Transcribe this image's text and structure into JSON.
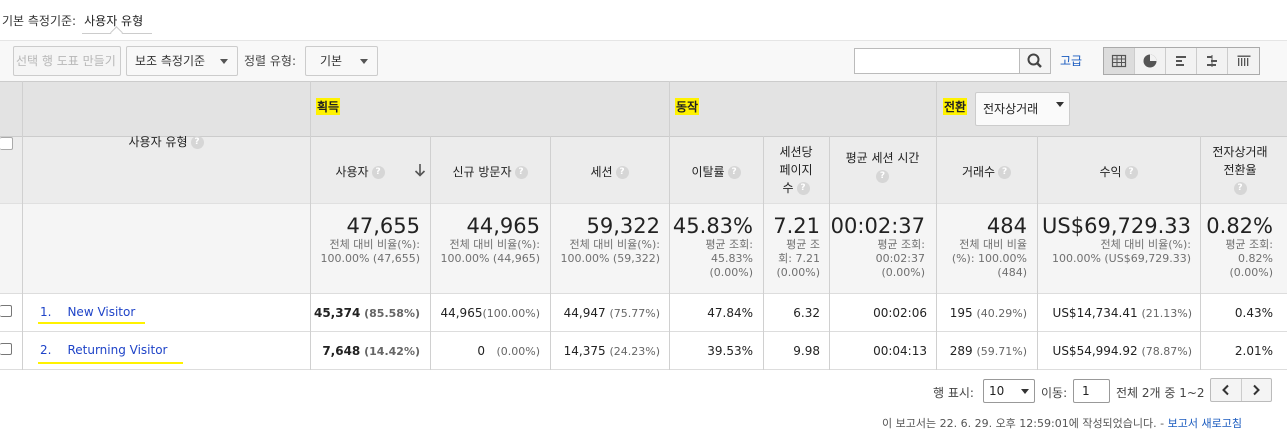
{
  "primary_dimension": {
    "label": "기본 측정기준:",
    "current": "사용자 유형"
  },
  "toolbar": {
    "create_chart": "선택 행 도표 만들기",
    "secondary_dimension": "보조 측정기준",
    "sort_type_label": "정렬 유형:",
    "sort_type_value": "기본",
    "advanced": "고급"
  },
  "table": {
    "dimension_header": "사용자 유형",
    "groups": {
      "acquisition": "획득",
      "behavior": "동작",
      "conversion": "전환",
      "conversion_select": "전자상거래"
    },
    "columns": {
      "users": "사용자",
      "new_visitors": "신규 방문자",
      "sessions": "세션",
      "bounce_rate": "이탈률",
      "pages_per_session_l1": "세션당",
      "pages_per_session_l2": "페이지",
      "pages_per_session_l3": "수",
      "avg_session_duration": "평균 세션 시간",
      "transactions": "거래수",
      "revenue": "수익",
      "ecommerce_rate_l1": "전자상거래",
      "ecommerce_rate_l2": "전환율"
    },
    "summary": {
      "users": {
        "value": "47,655",
        "sub1": "전체 대비 비율(%):",
        "sub2": "100.00% (47,655)"
      },
      "new_visitors": {
        "value": "44,965",
        "sub1": "전체 대비 비율(%):",
        "sub2": "100.00% (44,965)"
      },
      "sessions": {
        "value": "59,322",
        "sub1": "전체 대비 비율(%):",
        "sub2": "100.00% (59,322)"
      },
      "bounce_rate": {
        "value": "45.83%",
        "sub1": "평균 조회:",
        "sub2": "45.83%",
        "sub3": "(0.00%)"
      },
      "pages_per_session": {
        "value": "7.21",
        "sub1": "평균 조",
        "sub2": "회: 7.21",
        "sub3": "(0.00%)"
      },
      "avg_session_duration": {
        "value": "00:02:37",
        "sub1": "평균 조회:",
        "sub2": "00:02:37",
        "sub3": "(0.00%)"
      },
      "transactions": {
        "value": "484",
        "sub1": "전체 대비 비율",
        "sub2": "(%): 100.00%",
        "sub3": "(484)"
      },
      "revenue": {
        "value": "US$69,729.33",
        "sub1": "전체 대비 비율(%):",
        "sub2": "100.00% (US$69,729.33)"
      },
      "ecommerce_rate": {
        "value": "0.82%",
        "sub1": "평균 조회:",
        "sub2": "0.82%",
        "sub3": "(0.00%)"
      }
    },
    "rows": [
      {
        "index": "1.",
        "label": "New Visitor",
        "users": "45,374",
        "users_pct": "(85.58%)",
        "new_visitors": "44,965",
        "new_visitors_pct": "(100.00%)",
        "sessions": "44,947",
        "sessions_pct": "(75.77%)",
        "bounce_rate": "47.84%",
        "pages_per_session": "6.32",
        "avg_session_duration": "00:02:06",
        "transactions": "195",
        "transactions_pct": "(40.29%)",
        "revenue": "US$14,734.41",
        "revenue_pct": "(21.13%)",
        "ecommerce_rate": "0.43%"
      },
      {
        "index": "2.",
        "label": "Returning Visitor",
        "users": "7,648",
        "users_pct": "(14.42%)",
        "new_visitors": "0",
        "new_visitors_pct": "(0.00%)",
        "sessions": "14,375",
        "sessions_pct": "(24.23%)",
        "bounce_rate": "39.53%",
        "pages_per_session": "9.98",
        "avg_session_duration": "00:04:13",
        "transactions": "289",
        "transactions_pct": "(59.71%)",
        "revenue": "US$54,994.92",
        "revenue_pct": "(78.87%)",
        "ecommerce_rate": "2.01%"
      }
    ]
  },
  "pagination": {
    "rows_label": "행 표시:",
    "rows_value": "10",
    "goto_label": "이동:",
    "goto_value": "1",
    "range": "전체 2개 중 1~2"
  },
  "footer": {
    "text": "이 보고서는 22. 6. 29. 오후 12:59:01에 작성되었습니다. -",
    "refresh_link": "보고서 새로고침"
  },
  "colors": {
    "highlight": "#fff200",
    "link": "#1a5bbf"
  },
  "icons": [
    "search-icon",
    "table-view-icon",
    "pie-view-icon",
    "bar-view-icon",
    "comparison-view-icon",
    "pivot-view-icon",
    "sort-down-arrow-icon",
    "help-icon",
    "chevron-left-icon",
    "chevron-right-icon"
  ]
}
